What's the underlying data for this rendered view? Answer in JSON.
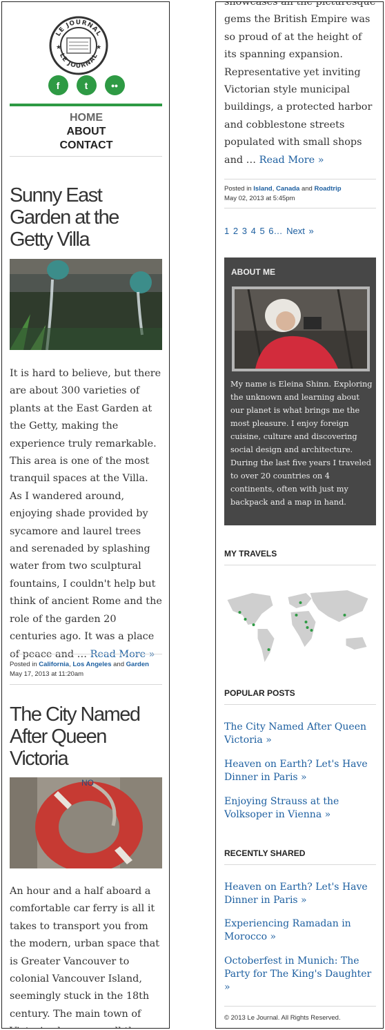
{
  "header": {
    "logo_text_top": "LE JOURNAL",
    "logo_text_bottom": "LE JOURNAL",
    "social": [
      {
        "icon": "facebook-icon",
        "glyph": "f"
      },
      {
        "icon": "twitter-icon",
        "glyph": "t"
      },
      {
        "icon": "flickr-icon",
        "glyph": "••"
      }
    ],
    "nav": [
      "HOME",
      "ABOUT",
      "CONTACT"
    ]
  },
  "posts": [
    {
      "title": "Sunny East Garden at the Getty Villa",
      "excerpt": "It is hard to believe, but there are about 300 varieties of plants at the East Garden at the Getty, making the experience truly remarkable. This area is one of the most tranquil spaces at the Villa. As I wandered around, enjoying shade provided by sycamore and laurel trees and serenaded by splashing water from two sculptural fountains, I couldn't help but think of ancient Rome and the role of the garden 20 centuries ago. It was a place of peace and …",
      "read_more": "Read More »",
      "posted_in": "Posted in",
      "categories": [
        "California",
        "Los Angeles",
        "Garden"
      ],
      "date": "May 17, 2013 at 11:20am"
    },
    {
      "title": "The City Named After Queen Victoria",
      "excerpt_left": "An hour and a half aboard a comfortable car ferry is all it takes to transport you from the modern, urban space that is Greater Vancouver to colonial Vancouver Island, seemingly stuck in the 18th century. The main town of Victoria showcases all the picturesque",
      "excerpt_right": "showcases all the picturesque gems the British Empire was so proud of at the height of its spanning expansion. Representative yet inviting Victorian style municipal buildings, a protected harbor and cobblestone streets populated with small shops and …",
      "read_more": "Read More »",
      "posted_in": "Posted in",
      "categories": [
        "Island",
        "Canada",
        "Roadtrip"
      ],
      "date": "May 02, 2013 at 5:45pm"
    }
  ],
  "pagination": {
    "pages": [
      "1",
      "2",
      "3",
      "4",
      "5",
      "6"
    ],
    "ellipsis": "…",
    "next": "Next »"
  },
  "about": {
    "heading": "ABOUT ME",
    "text": "My name is Eleina Shinn. Exploring the unknown and learning about our planet is what brings me the most pleasure. I enjoy foreign cuisine, culture and discovering social design and architecture. During the last five years I traveled to over 20 countries on 4 continents, often with just my backpack and a map in hand."
  },
  "travels": {
    "heading": "MY TRAVELS"
  },
  "popular": {
    "heading": "POPULAR POSTS",
    "items": [
      "The City Named After Queen Victoria »",
      "Heaven on Earth? Let's Have Dinner in Paris »",
      "Enjoying Strauss at the Volksoper in Vienna »"
    ]
  },
  "recent": {
    "heading": "RECENTLY SHARED",
    "items": [
      "Heaven on Earth? Let's Have Dinner in Paris »",
      "Experiencing Ramadan in Morocco »",
      "Octoberfest in Munich: The Party for The King's Daughter »"
    ]
  },
  "footer": {
    "copyright": "© 2013 Le Journal. All Rights Reserved."
  },
  "colors": {
    "accent": "#2e9a44",
    "link": "#1d5fa0",
    "widget_bg": "#474747"
  }
}
